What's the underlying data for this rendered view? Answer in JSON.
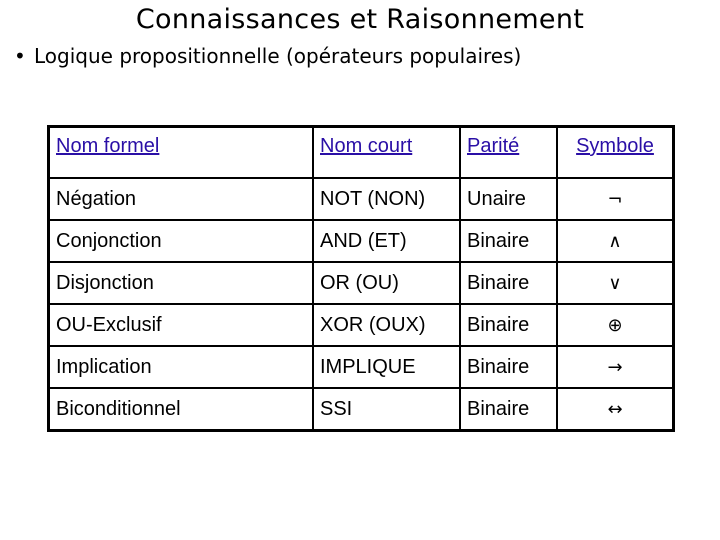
{
  "slide": {
    "title": "Connaissances et Raisonnement",
    "bullet": "•",
    "subtitle": "Logique propositionnelle (opérateurs populaires)"
  },
  "table": {
    "headers": [
      "Nom formel",
      "Nom court",
      "Parité",
      "Symbole"
    ],
    "link_color": "#2a0fa6",
    "rows": [
      {
        "formal": "Négation",
        "short": "NOT (NON)",
        "arity": "Unaire",
        "symbol": "¬",
        "symbol_name": "negation-icon"
      },
      {
        "formal": "Conjonction",
        "short": "AND (ET)",
        "arity": "Binaire",
        "symbol": "∧",
        "symbol_name": "logical-and-icon"
      },
      {
        "formal": "Disjonction",
        "short": "OR (OU)",
        "arity": "Binaire",
        "symbol": "∨",
        "symbol_name": "logical-or-icon"
      },
      {
        "formal": "OU-Exclusif",
        "short": "XOR (OUX)",
        "arity": "Binaire",
        "symbol": "⊕",
        "symbol_name": "xor-icon"
      },
      {
        "formal": "Implication",
        "short": "IMPLIQUE",
        "arity": "Binaire",
        "symbol": "→",
        "symbol_name": "right-arrow-icon"
      },
      {
        "formal": "Biconditionnel",
        "short": "SSI",
        "arity": "Binaire",
        "symbol": "↔",
        "symbol_name": "left-right-arrow-icon"
      }
    ]
  }
}
